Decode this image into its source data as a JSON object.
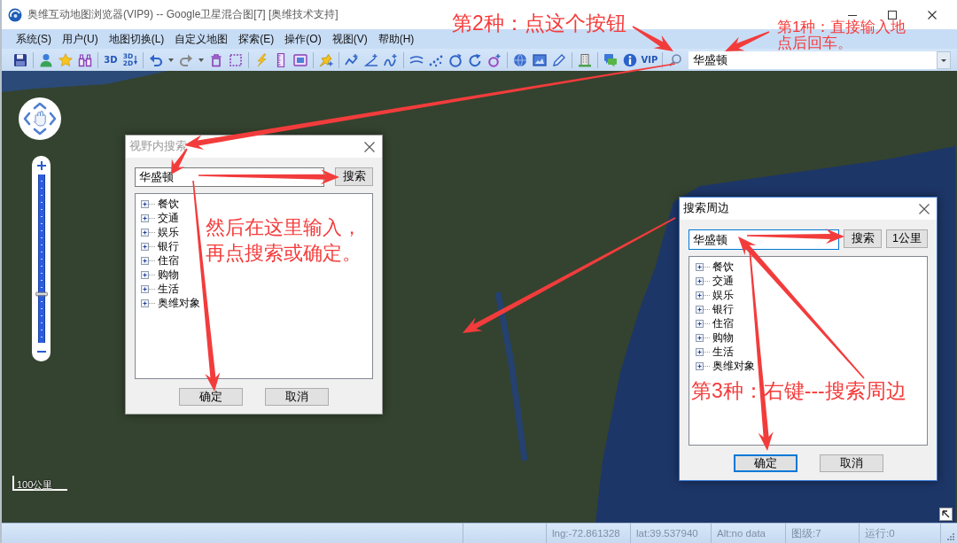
{
  "window": {
    "title": "奥维互动地图浏览器(VIP9) -- Google卫星混合图[7] [奥维技术支持]"
  },
  "menu": [
    {
      "label": "系统(S)"
    },
    {
      "label": "用户(U)"
    },
    {
      "label": "地图切换(L)"
    },
    {
      "label": "自定义地图"
    },
    {
      "label": "探索(E)"
    },
    {
      "label": "操作(O)"
    },
    {
      "label": "视图(V)"
    },
    {
      "label": "帮助(H)"
    }
  ],
  "toolbar": {
    "text_buttons": [
      {
        "label": "3D"
      },
      {
        "label": "3D",
        "sublabel": "2D"
      },
      {
        "label": "VIP"
      }
    ],
    "search_box": {
      "value": "华盛顿"
    }
  },
  "map_controls": {
    "zoom_slider": {
      "level": 0.29
    },
    "scale": "100公里"
  },
  "dialogs": [
    {
      "title": "视野内搜索",
      "active": false,
      "input": {
        "value": "华盛顿",
        "focused": false
      },
      "side_buttons": [
        {
          "label": "搜索"
        }
      ],
      "categories": [
        {
          "label": "餐饮",
          "expanded": false
        },
        {
          "label": "交通",
          "expanded": false
        },
        {
          "label": "娱乐",
          "expanded": false
        },
        {
          "label": "银行",
          "expanded": false
        },
        {
          "label": "住宿",
          "expanded": false
        },
        {
          "label": "购物",
          "expanded": false
        },
        {
          "label": "生活",
          "expanded": false
        },
        {
          "label": "奥维对象",
          "expanded": false
        }
      ],
      "buttons": [
        {
          "label": "确定",
          "default": false
        },
        {
          "label": "取消",
          "default": false
        }
      ]
    },
    {
      "title": "搜索周边",
      "active": true,
      "input": {
        "value": "华盛顿",
        "focused": true
      },
      "side_buttons": [
        {
          "label": "搜索"
        },
        {
          "label": "1公里"
        }
      ],
      "categories": [
        {
          "label": "餐饮",
          "expanded": false
        },
        {
          "label": "交通",
          "expanded": false
        },
        {
          "label": "娱乐",
          "expanded": false
        },
        {
          "label": "银行",
          "expanded": false
        },
        {
          "label": "住宿",
          "expanded": false
        },
        {
          "label": "购物",
          "expanded": false
        },
        {
          "label": "生活",
          "expanded": false
        },
        {
          "label": "奥维对象",
          "expanded": false
        }
      ],
      "buttons": [
        {
          "label": "确定",
          "default": true
        },
        {
          "label": "取消",
          "default": false
        }
      ]
    }
  ],
  "annotations": [
    {
      "text": "第2种：点这个按钮"
    },
    {
      "text": "第1种：直接输入地点后回车。"
    },
    {
      "text": "然后在这里输入，再点搜索或确定。"
    },
    {
      "text": "第3种：右键---搜索周边"
    }
  ],
  "status_bar": {
    "fields": [
      "lng:-72.861328",
      "lat:39.537940",
      "Alt:no data",
      "图级:7",
      "运行:0"
    ]
  }
}
